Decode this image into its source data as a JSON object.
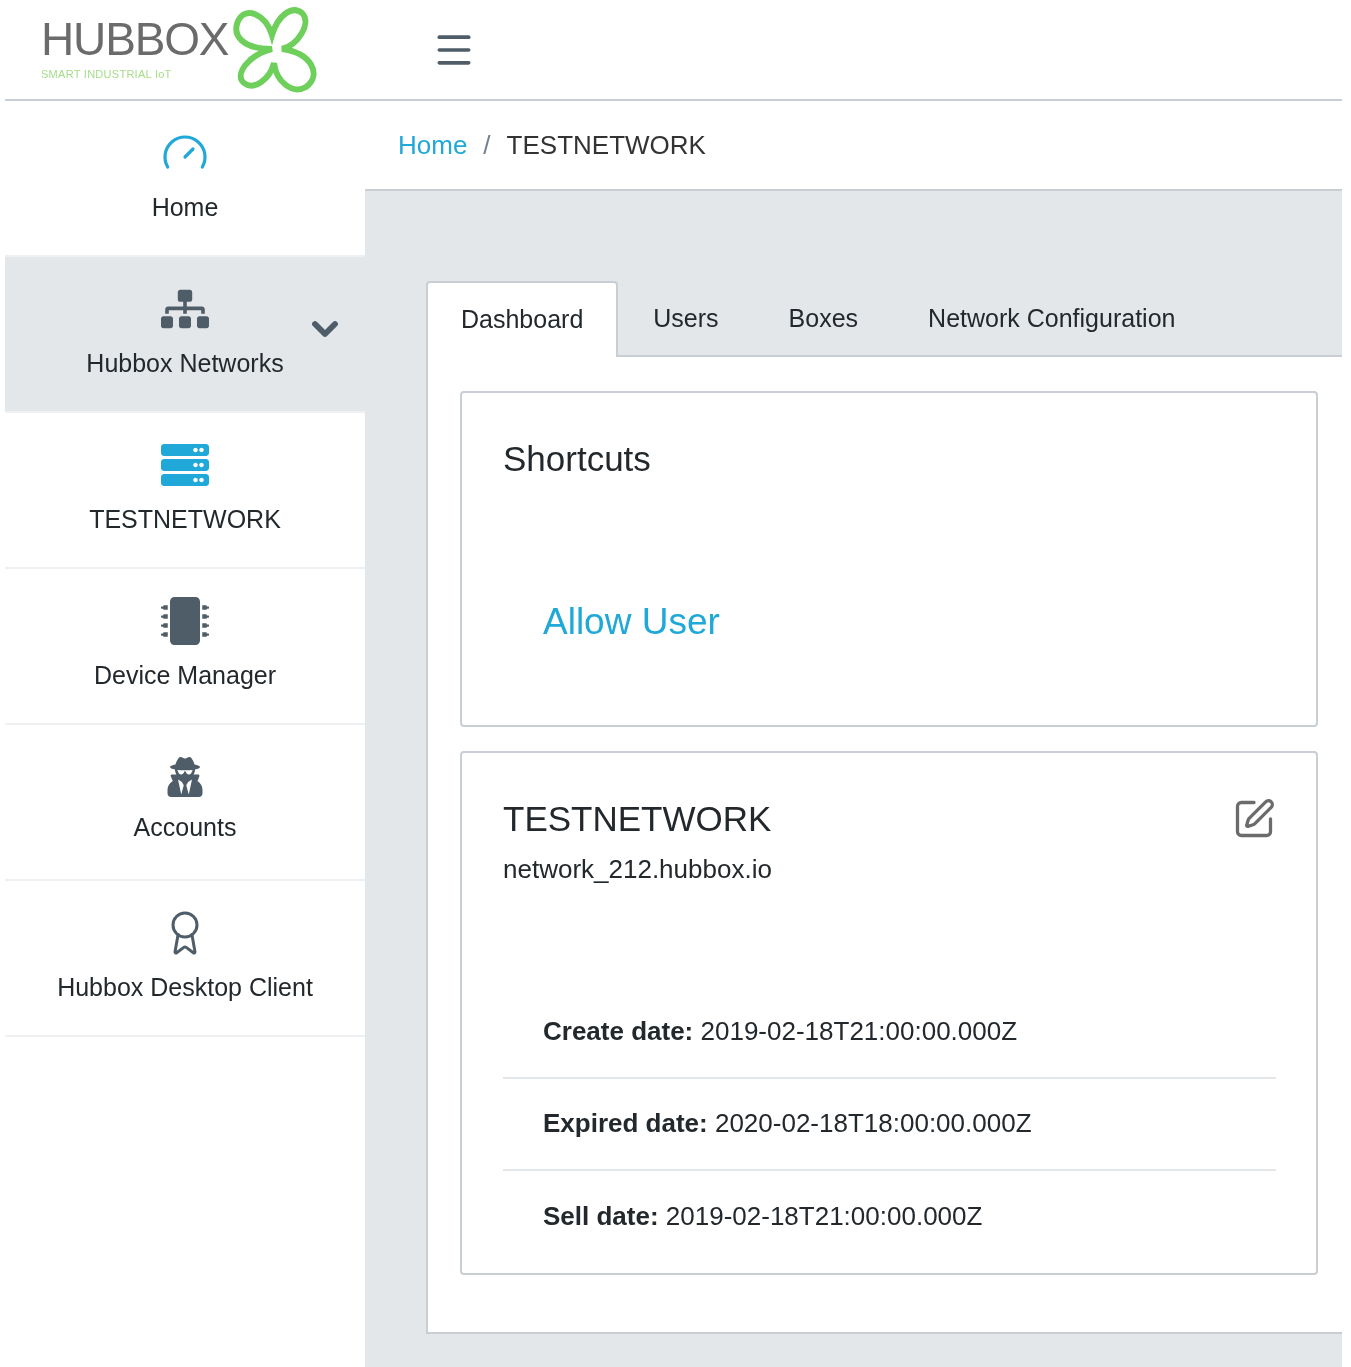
{
  "logo": {
    "name": "HUBBOX",
    "tagline": "SMART INDUSTRIAL IoT"
  },
  "sidebar": {
    "items": [
      {
        "label": "Home",
        "kind": "link",
        "selected": false,
        "highlighted": true
      },
      {
        "label": "Hubbox Networks",
        "kind": "group",
        "selected": true,
        "highlighted": false
      },
      {
        "label": "TESTNETWORK",
        "kind": "link",
        "selected": false,
        "highlighted": true
      },
      {
        "label": "Device Manager",
        "kind": "link",
        "selected": false,
        "highlighted": false
      },
      {
        "label": "Accounts",
        "kind": "link",
        "selected": false,
        "highlighted": false
      },
      {
        "label": "Hubbox Desktop Client",
        "kind": "link",
        "selected": false,
        "highlighted": false
      }
    ]
  },
  "breadcrumb": [
    {
      "label": "Home",
      "kind": "link"
    },
    {
      "label": "TESTNETWORK",
      "kind": "current"
    }
  ],
  "breadcrumb_separator": "/",
  "tabs": [
    {
      "label": "Dashboard",
      "selected": true
    },
    {
      "label": "Users",
      "selected": false
    },
    {
      "label": "Boxes",
      "selected": false
    },
    {
      "label": "Network Configuration",
      "selected": false
    }
  ],
  "shortcuts": {
    "title": "Shortcuts",
    "links": [
      "Allow User"
    ]
  },
  "network": {
    "name": "TESTNETWORK",
    "host": "network_212.hubbox.io",
    "details": [
      "**Create date:** 2019-02-18T21:00:00.000Z",
      "**Expired date:** 2020-02-18T18:00:00.000Z",
      "**Sell date:** 2019-02-18T21:00:00.000Z"
    ]
  }
}
